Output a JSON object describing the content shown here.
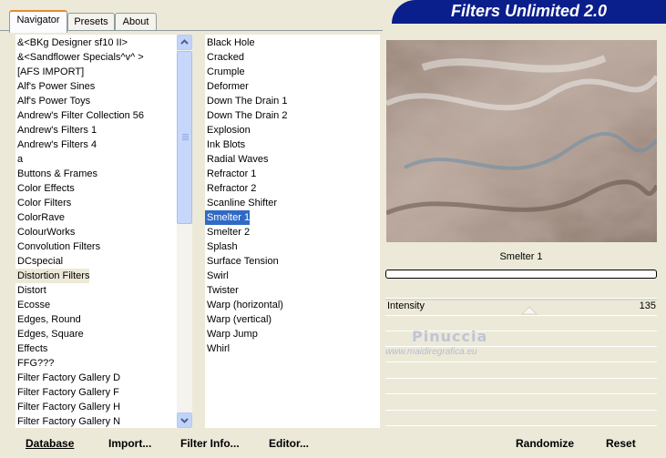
{
  "tabs": [
    {
      "label": "Navigator",
      "active": true
    },
    {
      "label": "Presets",
      "active": false
    },
    {
      "label": "About",
      "active": false
    }
  ],
  "banner": {
    "title": "Filters Unlimited 2.0",
    "color": "#0a1e8c"
  },
  "categories": [
    "&<BKg Designer sf10 II>",
    "&<Sandflower Specials^v^ >",
    "[AFS IMPORT]",
    "Alf's Power Sines",
    "Alf's Power Toys",
    "Andrew's Filter Collection 56",
    "Andrew's Filters 1",
    "Andrew's Filters 4",
    "a",
    "Buttons & Frames",
    "Color Effects",
    "Color Filters",
    "ColorRave",
    "ColourWorks",
    "Convolution Filters",
    "DCspecial",
    "Distortion Filters",
    "Distort",
    "Ecosse",
    "Edges, Round",
    "Edges, Square",
    "Effects",
    "FFG???",
    "Filter Factory Gallery D",
    "Filter Factory Gallery F",
    "Filter Factory Gallery H",
    "Filter Factory Gallery N"
  ],
  "selected_category": "Distortion Filters",
  "filters": [
    "Black Hole",
    "Cracked",
    "Crumple",
    "Deformer",
    "Down The Drain 1",
    "Down The Drain 2",
    "Explosion",
    "Ink Blots",
    "Radial Waves",
    "Refractor 1",
    "Refractor 2",
    "Scanline Shifter",
    "Smelter 1",
    "Smelter 2",
    "Splash",
    "Surface Tension",
    "Swirl",
    "Twister",
    "Warp (horizontal)",
    "Warp (vertical)",
    "Warp Jump",
    "Whirl"
  ],
  "selected_filter": "Smelter 1",
  "preview": {
    "caption": "Smelter 1",
    "progress": 0
  },
  "params": [
    {
      "label": "Intensity",
      "value": "135",
      "fraction": 0.53
    }
  ],
  "watermark": {
    "name": "Pinuccia",
    "site": "www.maidiregrafica.eu"
  },
  "buttons": {
    "database": "Database",
    "import": "Import...",
    "filter_info": "Filter Info...",
    "editor": "Editor...",
    "randomize": "Randomize",
    "reset": "Reset"
  }
}
